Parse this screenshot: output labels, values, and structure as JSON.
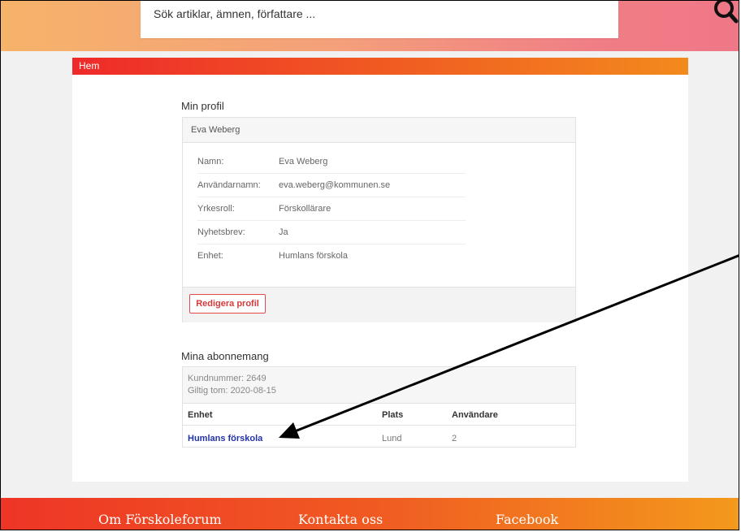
{
  "search": {
    "placeholder": "Sök artiklar, ämnen, författare ..."
  },
  "breadcrumb": {
    "home": "Hem"
  },
  "profile": {
    "section_title": "Min profil",
    "header_name": "Eva Weberg",
    "rows": [
      {
        "label": "Namn:",
        "value": "Eva Weberg"
      },
      {
        "label": "Användarnamn:",
        "value": "eva.weberg@kommunen.se"
      },
      {
        "label": "Yrkesroll:",
        "value": "Förskollärare"
      },
      {
        "label": "Nyhetsbrev:",
        "value": "Ja"
      },
      {
        "label": "Enhet:",
        "value": "Humlans förskola"
      }
    ],
    "edit_button": "Redigera profil"
  },
  "subscriptions": {
    "section_title": "Mina abonnemang",
    "customer_number": "Kundnummer: 2649",
    "valid_until": "Giltig tom: 2020-08-15",
    "columns": [
      "Enhet",
      "Plats",
      "Användare"
    ],
    "rows": [
      {
        "unit": "Humlans förskola",
        "place": "Lund",
        "users": "2"
      }
    ]
  },
  "footer": {
    "links": [
      "Om Förskoleforum",
      "Kontakta oss",
      "Facebook"
    ]
  },
  "colors": {
    "accent_red": "#ee2a2a",
    "accent_orange": "#f38a1d",
    "link_blue": "#2233aa",
    "button_red": "#d63a3a"
  },
  "icons": {
    "search": "search-icon",
    "annotation": "arrow-annotation-icon"
  }
}
